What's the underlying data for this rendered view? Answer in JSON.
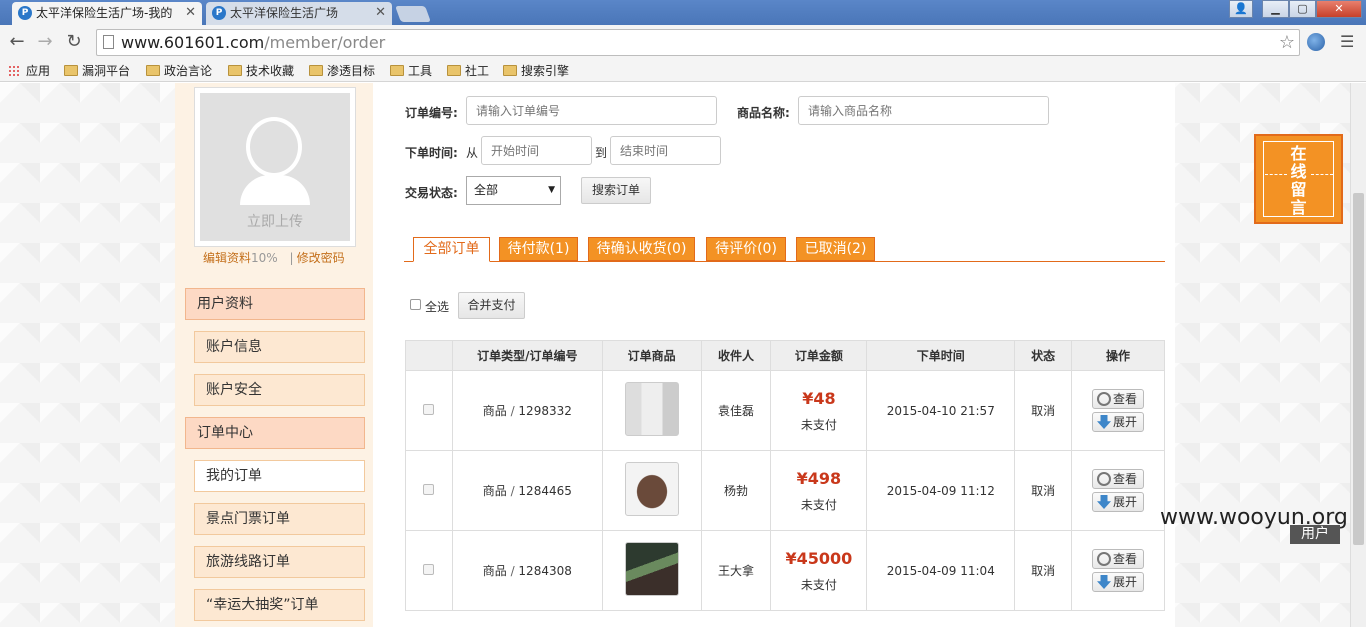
{
  "browser": {
    "tabs": [
      {
        "title": "太平洋保险生活广场-我的",
        "active": true
      },
      {
        "title": "太平洋保险生活广场",
        "active": false
      }
    ],
    "url_host": "www.601601.com",
    "url_path": "/member/order",
    "bookmarks": [
      "应用",
      "漏洞平台",
      "政治言论",
      "技术收藏",
      "渗透目标",
      "工具",
      "社工",
      "搜索引擎"
    ]
  },
  "sidebar": {
    "upload_label": "立即上传",
    "edit_profile": "编辑资料",
    "edit_pct": "10%",
    "divider": "|",
    "change_password": "修改密码",
    "groups": [
      {
        "label": "用户资料",
        "items": [
          "账户信息",
          "账户安全"
        ]
      },
      {
        "label": "订单中心",
        "items": [
          "我的订单",
          "景点门票订单",
          "旅游线路订单",
          "“幸运大抽奖”订单"
        ]
      }
    ],
    "active_item": "我的订单"
  },
  "filters": {
    "order_no_label": "订单编号:",
    "order_no_placeholder": "请输入订单编号",
    "product_label": "商品名称:",
    "product_placeholder": "请输入商品名称",
    "time_label": "下单时间:",
    "from": "从",
    "start_placeholder": "开始时间",
    "to": "到",
    "end_placeholder": "结束时间",
    "status_label": "交易状态:",
    "status_value": "全部",
    "search_button": "搜索订单"
  },
  "order_tabs": [
    "全部订单",
    "待付款(1)",
    "待确认收货(0)",
    "待评价(0)",
    "已取消(2)"
  ],
  "select_all": "全选",
  "merge_pay": "合并支付",
  "table": {
    "headers": [
      "",
      "订单类型/订单编号",
      "订单商品",
      "收件人",
      "订单金额",
      "下单时间",
      "状态",
      "操作"
    ],
    "rows": [
      {
        "type": "商品",
        "number": "1298332",
        "recipient": "袁佳磊",
        "amount": "¥48",
        "pay_status": "未支付",
        "time": "2015-04-10 21:57",
        "status": "取消"
      },
      {
        "type": "商品",
        "number": "1284465",
        "recipient": "杨勃",
        "amount": "¥498",
        "pay_status": "未支付",
        "time": "2015-04-09 11:12",
        "status": "取消"
      },
      {
        "type": "商品",
        "number": "1284308",
        "recipient": "王大拿",
        "amount": "¥45000",
        "pay_status": "未支付",
        "time": "2015-04-09 11:04",
        "status": "取消"
      }
    ],
    "view_label": "查看",
    "expand_label": "展开",
    "slash": " / "
  },
  "chat_widget": [
    "在",
    "线",
    "留",
    "言"
  ],
  "watermark": "www.wooyun.org",
  "user_tag": "用户",
  "colors": {
    "accent": "#f39224",
    "accent_dark": "#e26a1a",
    "price": "#c9381b"
  }
}
